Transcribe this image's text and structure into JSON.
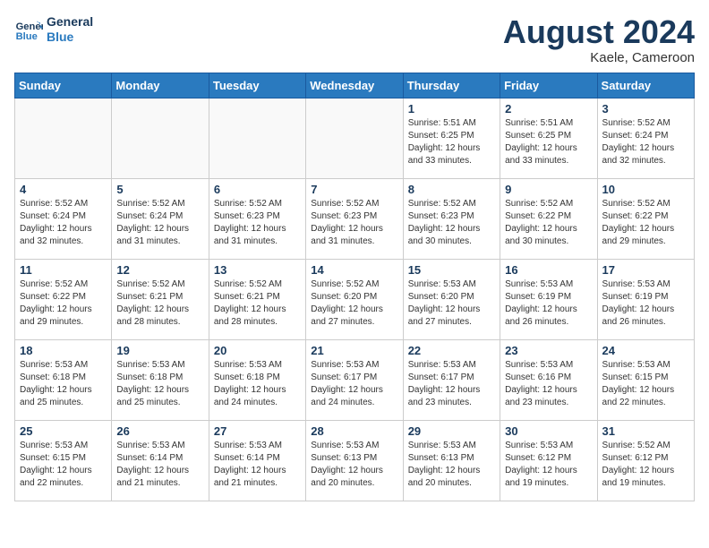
{
  "header": {
    "logo_line1": "General",
    "logo_line2": "Blue",
    "month_title": "August 2024",
    "location": "Kaele, Cameroon"
  },
  "weekdays": [
    "Sunday",
    "Monday",
    "Tuesday",
    "Wednesday",
    "Thursday",
    "Friday",
    "Saturday"
  ],
  "weeks": [
    [
      {
        "day": "",
        "info": ""
      },
      {
        "day": "",
        "info": ""
      },
      {
        "day": "",
        "info": ""
      },
      {
        "day": "",
        "info": ""
      },
      {
        "day": "1",
        "info": "Sunrise: 5:51 AM\nSunset: 6:25 PM\nDaylight: 12 hours\nand 33 minutes."
      },
      {
        "day": "2",
        "info": "Sunrise: 5:51 AM\nSunset: 6:25 PM\nDaylight: 12 hours\nand 33 minutes."
      },
      {
        "day": "3",
        "info": "Sunrise: 5:52 AM\nSunset: 6:24 PM\nDaylight: 12 hours\nand 32 minutes."
      }
    ],
    [
      {
        "day": "4",
        "info": "Sunrise: 5:52 AM\nSunset: 6:24 PM\nDaylight: 12 hours\nand 32 minutes."
      },
      {
        "day": "5",
        "info": "Sunrise: 5:52 AM\nSunset: 6:24 PM\nDaylight: 12 hours\nand 31 minutes."
      },
      {
        "day": "6",
        "info": "Sunrise: 5:52 AM\nSunset: 6:23 PM\nDaylight: 12 hours\nand 31 minutes."
      },
      {
        "day": "7",
        "info": "Sunrise: 5:52 AM\nSunset: 6:23 PM\nDaylight: 12 hours\nand 31 minutes."
      },
      {
        "day": "8",
        "info": "Sunrise: 5:52 AM\nSunset: 6:23 PM\nDaylight: 12 hours\nand 30 minutes."
      },
      {
        "day": "9",
        "info": "Sunrise: 5:52 AM\nSunset: 6:22 PM\nDaylight: 12 hours\nand 30 minutes."
      },
      {
        "day": "10",
        "info": "Sunrise: 5:52 AM\nSunset: 6:22 PM\nDaylight: 12 hours\nand 29 minutes."
      }
    ],
    [
      {
        "day": "11",
        "info": "Sunrise: 5:52 AM\nSunset: 6:22 PM\nDaylight: 12 hours\nand 29 minutes."
      },
      {
        "day": "12",
        "info": "Sunrise: 5:52 AM\nSunset: 6:21 PM\nDaylight: 12 hours\nand 28 minutes."
      },
      {
        "day": "13",
        "info": "Sunrise: 5:52 AM\nSunset: 6:21 PM\nDaylight: 12 hours\nand 28 minutes."
      },
      {
        "day": "14",
        "info": "Sunrise: 5:52 AM\nSunset: 6:20 PM\nDaylight: 12 hours\nand 27 minutes."
      },
      {
        "day": "15",
        "info": "Sunrise: 5:53 AM\nSunset: 6:20 PM\nDaylight: 12 hours\nand 27 minutes."
      },
      {
        "day": "16",
        "info": "Sunrise: 5:53 AM\nSunset: 6:19 PM\nDaylight: 12 hours\nand 26 minutes."
      },
      {
        "day": "17",
        "info": "Sunrise: 5:53 AM\nSunset: 6:19 PM\nDaylight: 12 hours\nand 26 minutes."
      }
    ],
    [
      {
        "day": "18",
        "info": "Sunrise: 5:53 AM\nSunset: 6:18 PM\nDaylight: 12 hours\nand 25 minutes."
      },
      {
        "day": "19",
        "info": "Sunrise: 5:53 AM\nSunset: 6:18 PM\nDaylight: 12 hours\nand 25 minutes."
      },
      {
        "day": "20",
        "info": "Sunrise: 5:53 AM\nSunset: 6:18 PM\nDaylight: 12 hours\nand 24 minutes."
      },
      {
        "day": "21",
        "info": "Sunrise: 5:53 AM\nSunset: 6:17 PM\nDaylight: 12 hours\nand 24 minutes."
      },
      {
        "day": "22",
        "info": "Sunrise: 5:53 AM\nSunset: 6:17 PM\nDaylight: 12 hours\nand 23 minutes."
      },
      {
        "day": "23",
        "info": "Sunrise: 5:53 AM\nSunset: 6:16 PM\nDaylight: 12 hours\nand 23 minutes."
      },
      {
        "day": "24",
        "info": "Sunrise: 5:53 AM\nSunset: 6:15 PM\nDaylight: 12 hours\nand 22 minutes."
      }
    ],
    [
      {
        "day": "25",
        "info": "Sunrise: 5:53 AM\nSunset: 6:15 PM\nDaylight: 12 hours\nand 22 minutes."
      },
      {
        "day": "26",
        "info": "Sunrise: 5:53 AM\nSunset: 6:14 PM\nDaylight: 12 hours\nand 21 minutes."
      },
      {
        "day": "27",
        "info": "Sunrise: 5:53 AM\nSunset: 6:14 PM\nDaylight: 12 hours\nand 21 minutes."
      },
      {
        "day": "28",
        "info": "Sunrise: 5:53 AM\nSunset: 6:13 PM\nDaylight: 12 hours\nand 20 minutes."
      },
      {
        "day": "29",
        "info": "Sunrise: 5:53 AM\nSunset: 6:13 PM\nDaylight: 12 hours\nand 20 minutes."
      },
      {
        "day": "30",
        "info": "Sunrise: 5:53 AM\nSunset: 6:12 PM\nDaylight: 12 hours\nand 19 minutes."
      },
      {
        "day": "31",
        "info": "Sunrise: 5:52 AM\nSunset: 6:12 PM\nDaylight: 12 hours\nand 19 minutes."
      }
    ]
  ]
}
